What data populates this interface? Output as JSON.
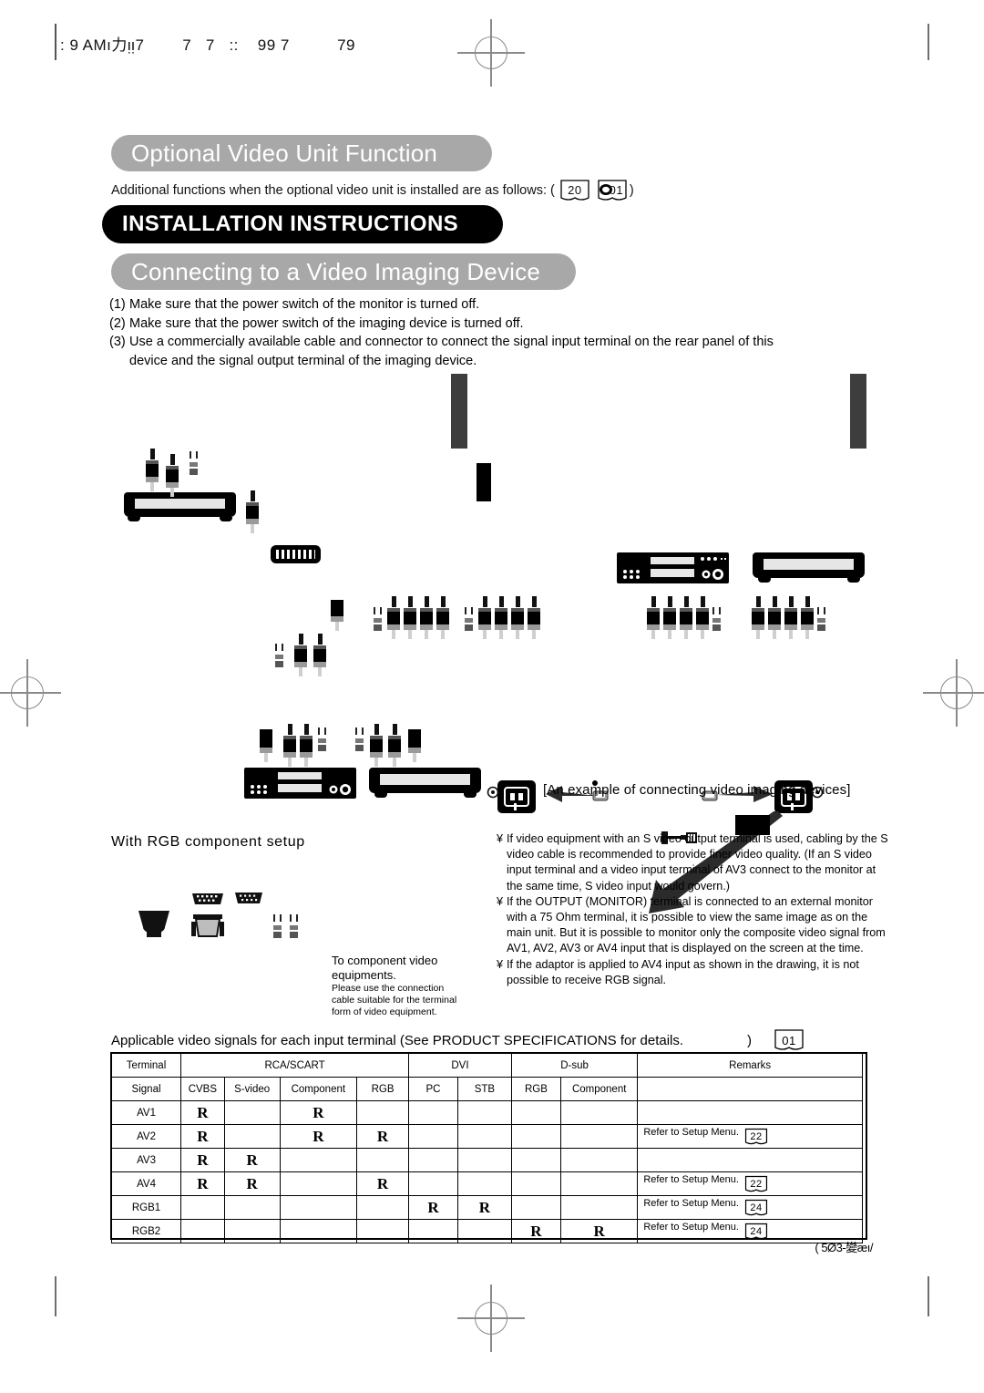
{
  "scan_header": {
    "text": ": 9 AMı力ᴉᴉ7        7   7   ::    99 7          79"
  },
  "sections": {
    "optional_title": "Optional Video Unit Function",
    "optional_intro_prefix": "Additional functions when the optional video unit is installed are as follows: (",
    "optional_intro_suffix": ")",
    "optional_ref_1": "20",
    "optional_ref_2": "01",
    "install_title": "INSTALLATION INSTRUCTIONS",
    "connecting_title": "Connecting to a Video Imaging Device"
  },
  "steps": [
    {
      "num": "(1)",
      "text": "Make sure that the power switch of the monitor is turned off."
    },
    {
      "num": "(2)",
      "text": "Make sure that the power switch of the imaging device is turned off."
    },
    {
      "num": "(3)",
      "text": "Use a commercially available cable and connector to connect the signal input terminal on the rear panel of this",
      "cont": "device and the signal output terminal of the imaging device."
    }
  ],
  "diagram": {
    "caption": "[An example of connecting video imaging devices]"
  },
  "rgb_setup": {
    "title": "With RGB component setup",
    "note_line1": "To component video",
    "note_line2": "equipments.",
    "note_line3": "Please use the connection",
    "note_line4": "cable suitable for the terminal",
    "note_line5": "form of video equipment."
  },
  "notes": [
    {
      "bullet": "¥",
      "text": "If video equipment with an S video output terminal is used, cabling by the S video cable is recommended to provide finer video quality. (If an S video input terminal and a video input terminal of AV3 connect to the monitor at the same time, S video input would govern.)"
    },
    {
      "bullet": "¥",
      "text": "If the OUTPUT (MONITOR) terminal is connected to an external monitor with a 75 Ohm terminal, it is possible to view the same image as on the main unit. But it is possible to monitor only the composite video signal from AV1, AV2, AV3 or AV4 input that is displayed on the screen at the time."
    },
    {
      "bullet": "¥",
      "text": "If the adaptor is applied to AV4 input as shown in the drawing, it is not possible to receive RGB signal."
    }
  ],
  "table": {
    "caption": "Applicable video signals for each input terminal (See PRODUCT SPECIFICATIONS for details.",
    "caption_suffix": ")",
    "caption_ref": "01",
    "group_headers": [
      {
        "label": "Terminal",
        "span": 1
      },
      {
        "label": "RCA/SCART",
        "span": 4
      },
      {
        "label": "DVI",
        "span": 2
      },
      {
        "label": "D-sub",
        "span": 2
      },
      {
        "label": "Remarks",
        "span": 1
      }
    ],
    "sub_headers": [
      "Signal",
      "CVBS",
      "S-video",
      "Component",
      "RGB",
      "PC",
      "STB",
      "RGB",
      "Component",
      ""
    ],
    "mark": "R",
    "rows": [
      {
        "terminal": "AV1",
        "cells": [
          "R",
          "",
          "R",
          "",
          "",
          "",
          "",
          ""
        ],
        "remark": "",
        "remark_ref": ""
      },
      {
        "terminal": "AV2",
        "cells": [
          "R",
          "",
          "R",
          "R",
          "",
          "",
          "",
          ""
        ],
        "remark": "Refer to Setup Menu.",
        "remark_ref": "22"
      },
      {
        "terminal": "AV3",
        "cells": [
          "R",
          "R",
          "",
          "",
          "",
          "",
          "",
          ""
        ],
        "remark": "",
        "remark_ref": ""
      },
      {
        "terminal": "AV4",
        "cells": [
          "R",
          "R",
          "",
          "R",
          "",
          "",
          "",
          ""
        ],
        "remark": "Refer to Setup Menu.",
        "remark_ref": "22"
      },
      {
        "terminal": "RGB1",
        "cells": [
          "",
          "",
          "",
          "",
          "R",
          "R",
          "",
          ""
        ],
        "remark": "Refer to Setup Menu.",
        "remark_ref": "24"
      },
      {
        "terminal": "RGB2",
        "cells": [
          "",
          "",
          "",
          "",
          "",
          "",
          "R",
          "R"
        ],
        "remark": "Refer to Setup Menu.",
        "remark_ref": "24"
      }
    ]
  },
  "footnote": "( 5Ø3-變æı/",
  "colors": {
    "banner_grey": "#a8a8a8",
    "banner_black": "#000000",
    "text": "#111111",
    "mark_grey": "#8a8a8a"
  }
}
